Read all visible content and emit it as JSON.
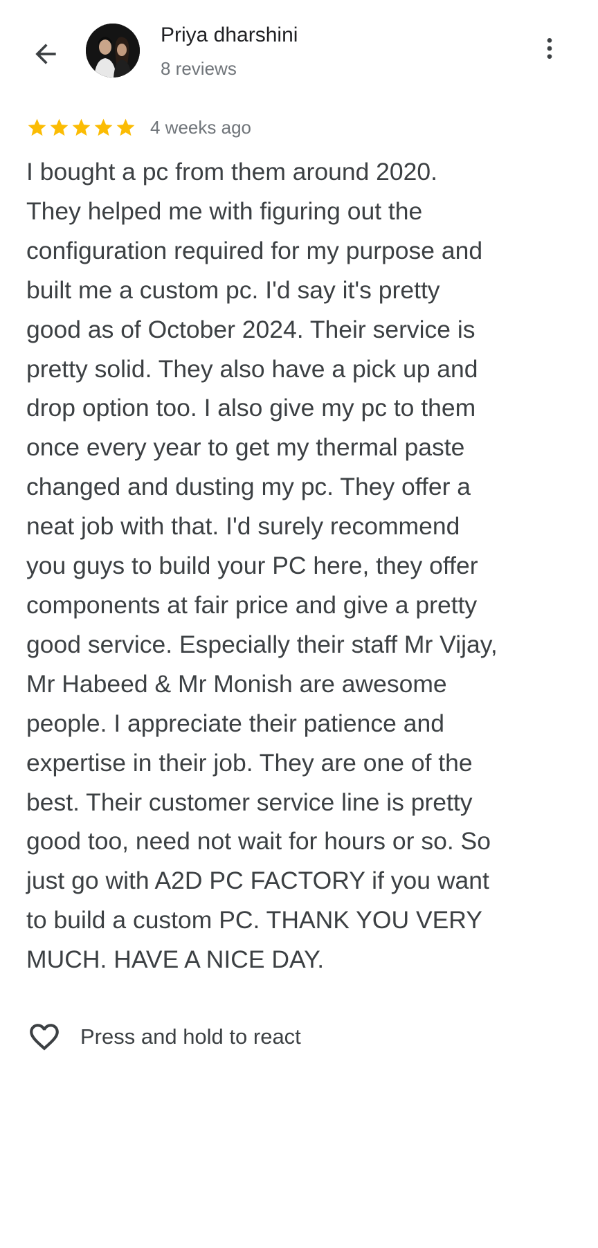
{
  "header": {
    "back_icon": "arrow-back-icon",
    "author_name": "Priya dharshini",
    "author_reviews": "8 reviews",
    "more_icon": "more-vert-icon"
  },
  "review": {
    "rating": 5,
    "max_rating": 5,
    "star_color": "#fbbc04",
    "time_ago": "4 weeks ago",
    "text": "I bought a pc from them around 2020.\nThey helped me with figuring out the\nconfiguration required for my purpose and\nbuilt me a custom pc. I'd say it's pretty\ngood as of October 2024. Their service is\npretty solid. They also have a pick up and\ndrop option too. I also give my pc to them\nonce every year to get my thermal paste\nchanged and dusting my pc. They offer a\nneat job with that. I'd surely recommend\nyou guys to build your PC here, they offer\ncomponents at fair price and give a pretty\ngood service. Especially their staff Mr Vijay,\nMr Habeed & Mr Monish are awesome\npeople. I appreciate their patience and\nexpertise in their job. They are one of the\nbest. Their customer service line is pretty\ngood too, need not wait for hours or so. So\njust go with A2D PC FACTORY if you want\nto build a custom PC. THANK YOU VERY\nMUCH. HAVE A NICE DAY."
  },
  "reaction": {
    "icon": "heart-outline-icon",
    "label": "Press and hold to react"
  }
}
